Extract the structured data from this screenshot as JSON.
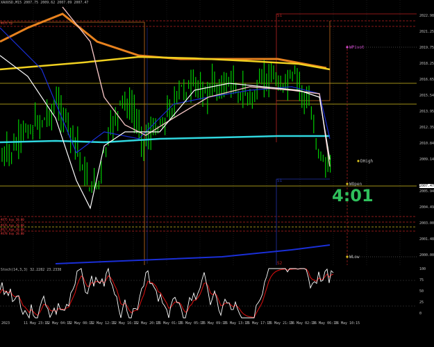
{
  "chart": {
    "symbol": "XAUUSD,M15  2007.75 2009.62 2007.09 2007.47",
    "countdown": "4:01",
    "current_price": "2007.47",
    "osc_title": "Stoch(14,3,3) 32.2282 23.2338",
    "price_axis": [
      "2022.98",
      "2021.25",
      "2019.75",
      "2018.25",
      "2016.65",
      "2015.54",
      "2013.95",
      "2012.35",
      "2010.84",
      "2009.14",
      "2007.47",
      "2005.94",
      "2004.49",
      "2003.00",
      "2001.48",
      "2000.00"
    ],
    "osc_axis": [
      "100",
      "75",
      "50",
      "25",
      "0"
    ],
    "time_labels": [
      "2023",
      "11 May 23:15",
      "12 May 04:15",
      "12 May 08:15",
      "12 May 12:15",
      "12 May 16:15",
      "12 May 20:15",
      "15 May 01:15",
      "15 May 05:15",
      "15 May 09:15",
      "15 May 13:15",
      "15 May 17:15",
      "15 May 21:15",
      "16 May 02:15",
      "16 May 06:15",
      "16 May 10:15"
    ],
    "markers": {
      "wpivot": "WPivot",
      "dhigh": "DHigh",
      "wopen": "WOpen",
      "wlow": "WLow",
      "s1_top": "S1",
      "s1_mid": "S1",
      "s2_bottom": "S2"
    },
    "orders": [
      "#475 tp",
      "#475 buy 20.00",
      "#476 buy 20.00",
      "#477 buy 20.00",
      "#478 buy 20.00"
    ],
    "colors": {
      "candles": "#00cc00",
      "ma_orange": "#e8821e",
      "ma_yellow": "#f0d020",
      "ma_cyan": "#30d8e0",
      "ma_blue": "#1a2fd8",
      "ma_pink": "#f0c0c0",
      "ma_white": "#ffffff",
      "stoch_main": "#ffffff",
      "stoch_signal": "#d01010"
    }
  }
}
